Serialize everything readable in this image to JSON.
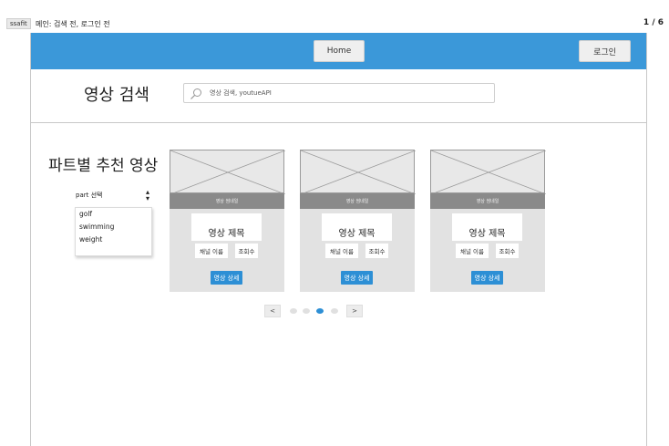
{
  "header": {
    "project_tag": "ssafit",
    "page_title": "메인: 검색 전, 로그인 전",
    "page_counter": "1 / 6"
  },
  "navbar": {
    "home_label": "Home",
    "login_label": "로그인",
    "color": "#3b98d9"
  },
  "search": {
    "title": "영상 검색",
    "placeholder": "영상 검색, youtueAPI",
    "icon": "search-icon"
  },
  "recommend": {
    "title": "파트별 추천 영상",
    "select_label": "part 선택",
    "options": [
      "golf",
      "swimming",
      "weight"
    ]
  },
  "cards": [
    {
      "thumbnail_label": "영상 썸네일",
      "title": "영상 제목",
      "channel": "채널 이름",
      "views": "조회수",
      "detail_label": "영상 상세"
    },
    {
      "thumbnail_label": "영상 썸네일",
      "title": "영상 제목",
      "channel": "채널 이름",
      "views": "조회수",
      "detail_label": "영상 상세"
    },
    {
      "thumbnail_label": "영상 썸네일",
      "title": "영상 제목",
      "channel": "채널 이름",
      "views": "조회수",
      "detail_label": "영상 상세"
    }
  ],
  "pagination": {
    "prev_label": "<",
    "next_label": ">",
    "page_count": 4,
    "active_index": 2,
    "active_color": "#2d8fd5"
  }
}
